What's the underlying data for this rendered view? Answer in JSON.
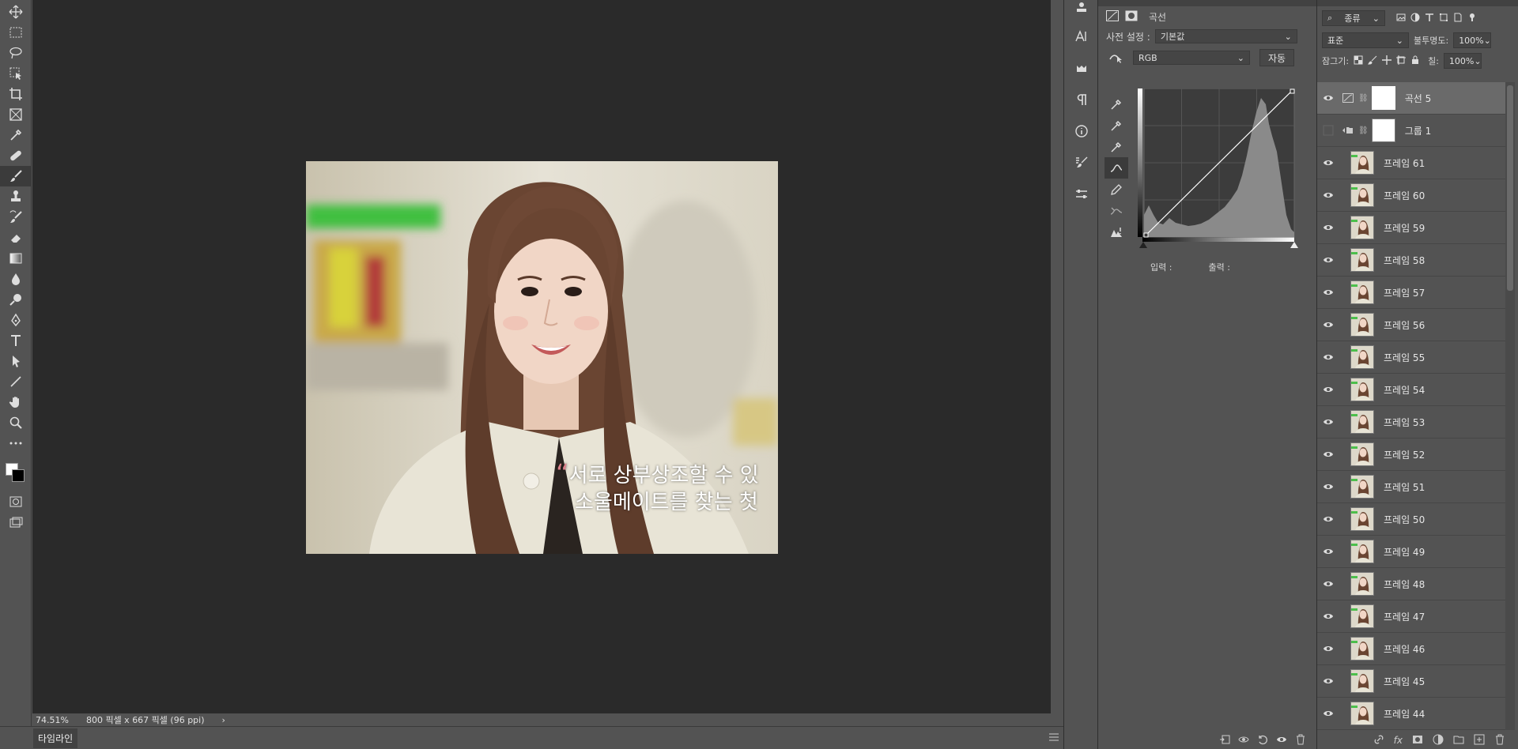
{
  "tools": [
    "move",
    "marquee",
    "lasso",
    "object-select",
    "crop",
    "frame",
    "eyedropper",
    "healing",
    "brush",
    "stamp",
    "history-brush",
    "eraser",
    "gradient",
    "blur",
    "dodge",
    "pen",
    "type",
    "path-select",
    "line",
    "hand",
    "zoom",
    "more"
  ],
  "status": {
    "zoom": "74.51%",
    "doc_info": "800 픽셀 x 667 픽셀 (96 ppi)",
    "arrow": "›"
  },
  "timeline": {
    "label": "타임라인"
  },
  "canvas_caption": {
    "quote": "“",
    "line1": "서로 상부상조할 수 있",
    "line2": "소울메이트를 찾는 첫"
  },
  "properties": {
    "title": "곡선",
    "preset_label": "사전 설정 :",
    "preset_value": "기본값",
    "channel_value": "RGB",
    "auto_button": "자동",
    "input_label": "입력 :",
    "output_label": "출력 :"
  },
  "layers_panel": {
    "filter_label": "종류",
    "blend_mode": "표준",
    "opacity_label": "불투명도:",
    "opacity_value": "100%",
    "lock_label": "잠그기:",
    "fill_label": "칠:",
    "fill_value": "100%",
    "items": [
      {
        "name": "곡선 5",
        "kind": "adjustment",
        "visible": true,
        "selected": true
      },
      {
        "name": "그룹 1",
        "kind": "group",
        "visible": false,
        "selected": false
      },
      {
        "name": "프레임 61",
        "kind": "frame",
        "visible": true
      },
      {
        "name": "프레임 60",
        "kind": "frame",
        "visible": true
      },
      {
        "name": "프레임 59",
        "kind": "frame",
        "visible": true
      },
      {
        "name": "프레임 58",
        "kind": "frame",
        "visible": true
      },
      {
        "name": "프레임 57",
        "kind": "frame",
        "visible": true
      },
      {
        "name": "프레임 56",
        "kind": "frame",
        "visible": true
      },
      {
        "name": "프레임 55",
        "kind": "frame",
        "visible": true
      },
      {
        "name": "프레임 54",
        "kind": "frame",
        "visible": true
      },
      {
        "name": "프레임 53",
        "kind": "frame",
        "visible": true
      },
      {
        "name": "프레임 52",
        "kind": "frame",
        "visible": true
      },
      {
        "name": "프레임 51",
        "kind": "frame",
        "visible": true
      },
      {
        "name": "프레임 50",
        "kind": "frame",
        "visible": true
      },
      {
        "name": "프레임 49",
        "kind": "frame",
        "visible": true
      },
      {
        "name": "프레임 48",
        "kind": "frame",
        "visible": true
      },
      {
        "name": "프레임 47",
        "kind": "frame",
        "visible": true
      },
      {
        "name": "프레임 46",
        "kind": "frame",
        "visible": true
      },
      {
        "name": "프레임 45",
        "kind": "frame",
        "visible": true
      },
      {
        "name": "프레임 44",
        "kind": "frame",
        "visible": true
      }
    ]
  }
}
